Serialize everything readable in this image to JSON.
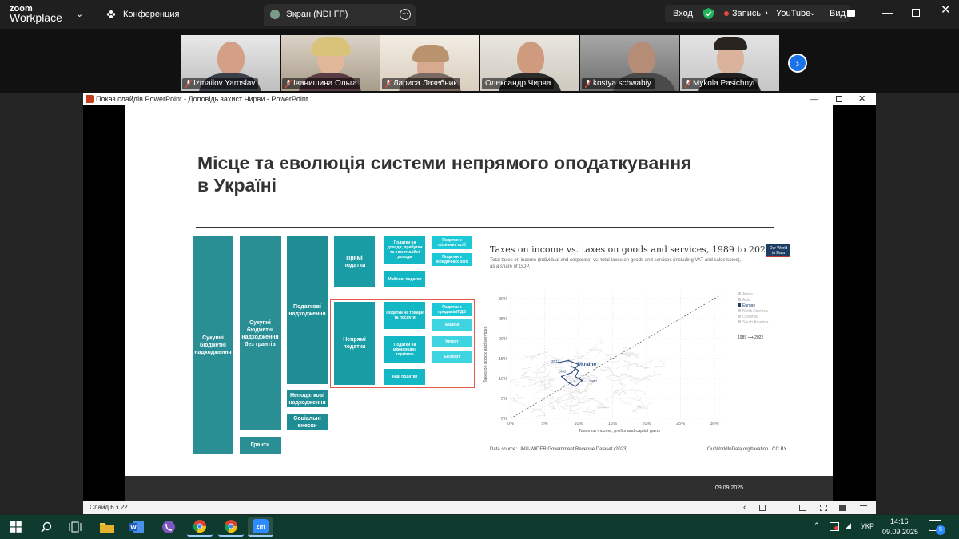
{
  "zoom": {
    "logo_top": "zoom",
    "logo_bottom": "Workplace",
    "meeting_label": "Конференция",
    "screen_tab": "Экран (NDI FP)",
    "signin": "Вход",
    "record": "Запись",
    "youtube": "YouTube",
    "view": "Вид",
    "accent": "#37d07a"
  },
  "participants": [
    {
      "name": "Izmailov Yaroslav"
    },
    {
      "name": "Іванишина Ольга"
    },
    {
      "name": "Лариса Лазебник"
    },
    {
      "name": "Олександр Чирва",
      "active": true
    },
    {
      "name": "kostya schwabiy"
    },
    {
      "name": "Mykola Pasichnyi"
    }
  ],
  "ppt": {
    "window_title": "Показ слайдів PowerPoint  -  Доповідь захист Чирви - PowerPoint",
    "status_slide": "Слайд 6 з 22",
    "footer_date": "09.09.2025"
  },
  "slide": {
    "title": "Місце та еволюція системи непрямого оподаткування в Україні",
    "boxes": {
      "total_revenue": "Сукупні бюджетні надходження",
      "total_no_grants": "Сукупні бюджетні надходження без грантів",
      "grants": "Гранти",
      "tax_revenue": "Податкові надходження",
      "nontax_revenue": "Неподаткові надходження",
      "social": "Соціальні внески",
      "direct": "Прямі податки",
      "indirect": "Непрямі податки",
      "income_tax": "Податки на доходи, прибутки та інвестиційні доходи",
      "property_tax": "Майнові податки",
      "goods_tax": "Податки на товари та послуги",
      "trade_tax": "Податки на міжнародну торгівлю",
      "other_tax": "Інші податки",
      "pit": "Податки з фізичних осіб",
      "cit": "Податки з юридичних осіб",
      "vat": "Податки з продажів/ПДВ",
      "excise": "Акцизи",
      "import": "Імпорт",
      "export": "Експорт"
    },
    "chart": {
      "title": "Taxes on income vs. taxes on goods and services, 1989 to 2022",
      "subtitle": "Total taxes on income (individual and corporate) vs. total taxes on goods and services (including VAT and sales taxes), as a share of GDP.",
      "logo_line1": "Our World",
      "logo_line2": "in Data",
      "source": "Data source: UNU-WIDER Government Revenue Dataset (2023)",
      "url": "OurWorldInData.org/taxation | CC BY",
      "highlight": "Ukraine",
      "legend_range": "1989 ⟶ 2022"
    }
  },
  "chart_data": {
    "type": "scatter",
    "title": "Taxes on income vs. taxes on goods and services, 1989 to 2022",
    "xlabel": "Taxes on income, profits and capital gains",
    "ylabel": "Taxes on goods and services",
    "xlim": [
      0,
      32
    ],
    "ylim": [
      0,
      32
    ],
    "x_ticks": [
      "0%",
      "5%",
      "10%",
      "15%",
      "20%",
      "25%",
      "30%"
    ],
    "y_ticks": [
      "0%",
      "5%",
      "10%",
      "15%",
      "20%",
      "25%",
      "30%"
    ],
    "legend": [
      {
        "name": "Africa",
        "color": "#d0d0d0"
      },
      {
        "name": "Asia",
        "color": "#d0d0d0"
      },
      {
        "name": "Europe",
        "color": "#1d3d63"
      },
      {
        "name": "North America",
        "color": "#d0d0d0"
      },
      {
        "name": "Oceania",
        "color": "#d0d0d0"
      },
      {
        "name": "South America",
        "color": "#d0d0d0"
      }
    ],
    "ukraine_path": [
      {
        "x": 7.0,
        "y": 14.0
      },
      {
        "x": 8.5,
        "y": 14.5
      },
      {
        "x": 10.0,
        "y": 13.5
      },
      {
        "x": 9.0,
        "y": 11.5
      },
      {
        "x": 7.5,
        "y": 10.5
      },
      {
        "x": 8.5,
        "y": 9.0
      },
      {
        "x": 9.5,
        "y": 8.0
      },
      {
        "x": 10.5,
        "y": 9.5
      },
      {
        "x": 9.5,
        "y": 10.5
      },
      {
        "x": 10.0,
        "y": 12.0
      },
      {
        "x": 9.0,
        "y": 13.0
      }
    ],
    "ukraine_year_labels": [
      {
        "label": "2013",
        "x": 6.0,
        "y": 14.0
      },
      {
        "label": "2002",
        "x": 7.0,
        "y": 11.5
      },
      {
        "label": "1990",
        "x": 11.5,
        "y": 9.0
      }
    ]
  },
  "taskbar": {
    "lang": "УКР",
    "time": "14:16",
    "date": "09.09.2025",
    "notifications": "5"
  }
}
